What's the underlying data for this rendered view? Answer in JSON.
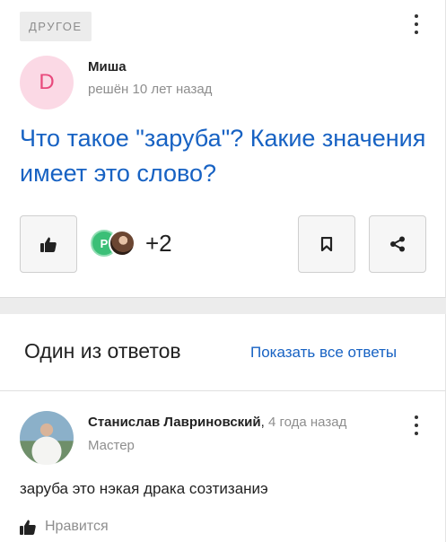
{
  "question": {
    "category": "ДРУГОЕ",
    "author_initial": "D",
    "author": "Миша",
    "status": "решён 10 лет назад",
    "title": "Что такое \"заруба\"? Какие значения имеет это слово?",
    "voter_initial": "P",
    "voters_more": "+2",
    "icons": {
      "like": "thumbs-up-icon",
      "bookmark": "bookmark-icon",
      "share": "share-icon",
      "menu": "more-vertical-icon"
    }
  },
  "answers": {
    "title": "Один из ответов",
    "show_all": "Показать все ответы",
    "items": [
      {
        "author": "Станислав Лавриновский",
        "time": "4 года назад",
        "rank": "Мастер",
        "text": "заруба это нэкая драка созтизаниэ",
        "like_label": "Нравится"
      }
    ]
  },
  "colors": {
    "accent": "#1762c3",
    "avatar_bg": "#fbd9e5",
    "avatar_letter": "#e8497c",
    "voter_green": "#3bbf77"
  }
}
